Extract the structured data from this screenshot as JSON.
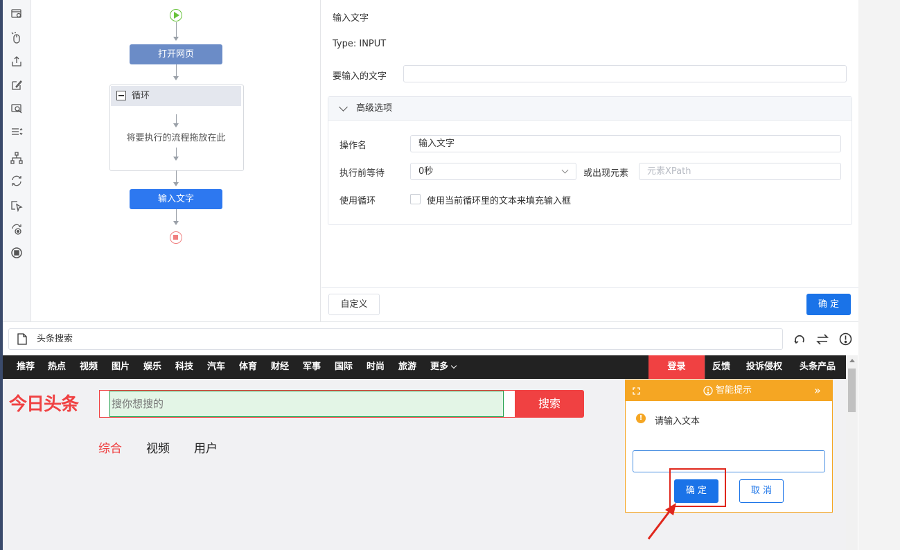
{
  "flow": {
    "node_open_page": "打开网页",
    "loop_label": "循环",
    "loop_placeholder": "将要执行的流程拖放在此",
    "node_input_text": "输入文字"
  },
  "props": {
    "title": "输入文字",
    "type_text": "Type: INPUT",
    "text_to_input_label": "要输入的文字",
    "text_to_input_value": "",
    "advanced_label": "高级选项",
    "op_name_label": "操作名",
    "op_name_value": "输入文字",
    "wait_label": "执行前等待",
    "wait_value": "0秒",
    "or_appear_label": "或出现元素",
    "xpath_placeholder": "元素XPath",
    "use_loop_label": "使用循环",
    "use_loop_checkbox_label": "使用当前循环里的文本来填充输入框",
    "custom_button": "自定义",
    "confirm_button": "确 定"
  },
  "browser": {
    "page_title": "头条搜索"
  },
  "site": {
    "nav_left": [
      "推荐",
      "热点",
      "视频",
      "图片",
      "娱乐",
      "科技",
      "汽车",
      "体育",
      "财经",
      "军事",
      "国际",
      "时尚",
      "旅游",
      "更多"
    ],
    "login": "登录",
    "nav_right": [
      "反馈",
      "投诉侵权",
      "头条产品"
    ],
    "logo": "今日头条",
    "search_placeholder": "搜你想搜的",
    "search_button": "搜索",
    "tabs": [
      "综合",
      "视频",
      "用户"
    ],
    "accent_color": "#f04142"
  },
  "tip": {
    "title": "智能提示",
    "message": "请输入文本",
    "input_value": "",
    "confirm": "确 定",
    "cancel": "取 消"
  }
}
